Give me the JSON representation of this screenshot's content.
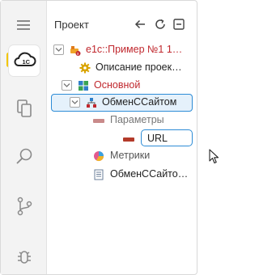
{
  "panel": {
    "title": "Проект"
  },
  "tree": {
    "root_label": "e1c::Пример №1 1…",
    "description_label": "Описание проек…",
    "main_label": "Основной",
    "exchange_label": "ОбменССайтом",
    "params_label": "Параметры",
    "url_value": "URL",
    "metrics_label": "Метрики",
    "exchange_module_label": "ОбменССайто…"
  },
  "colors": {
    "accent": "#2d8cd6",
    "error_red": "#c0272d",
    "activity_marker": "#f2c500"
  },
  "icons": {
    "activity": [
      "menu-icon",
      "1c-cloud-icon",
      "copy-icon",
      "search-icon",
      "source-control-icon",
      "debug-icon"
    ],
    "toolbar": [
      "back-arrow-icon",
      "refresh-icon",
      "collapse-icon"
    ]
  }
}
